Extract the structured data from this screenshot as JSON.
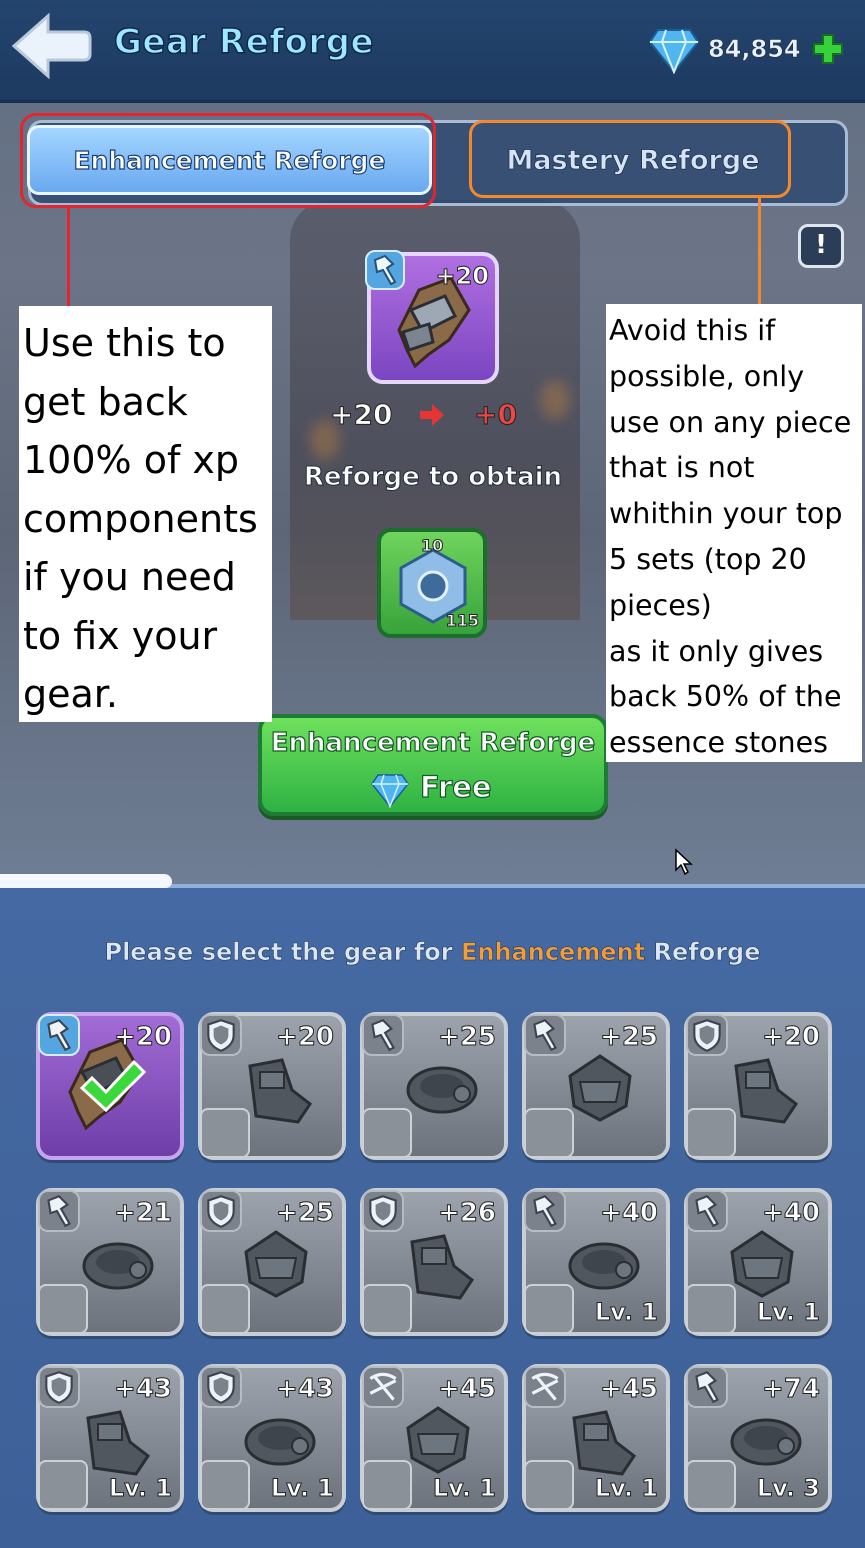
{
  "header": {
    "title": "Gear Reforge",
    "gems": "84,854"
  },
  "tabs": [
    {
      "label": "Enhancement Reforge",
      "active": true
    },
    {
      "label": "Mastery Reforge",
      "active": false
    }
  ],
  "current_gear": {
    "level": "+20",
    "from": "+20",
    "to": "+0"
  },
  "reforge_obtain_label": "Reforge to obtain",
  "reward": {
    "top_count": "10",
    "bottom_count": "115"
  },
  "action_button": {
    "label": "Enhancement Reforge",
    "cost": "Free"
  },
  "annotations": {
    "left_note": [
      "Use this to",
      "get back",
      "100% of xp",
      "components",
      "if you need",
      "to fix your",
      "gear."
    ],
    "right_note": [
      "Avoid this if",
      "possible, only",
      "use on any piece",
      "that is not",
      "whithin your top",
      "5 sets (top 20",
      "pieces)",
      "as it only gives",
      "back 50% of the",
      "essence stones"
    ]
  },
  "select_prompt": {
    "prefix": "Please select the gear for ",
    "highlight": "Enhancement",
    "suffix": " Reforge"
  },
  "gear_list": [
    {
      "plus": "+20",
      "type": "hammer",
      "selected": true,
      "lv": ""
    },
    {
      "plus": "+20",
      "type": "shield",
      "selected": false,
      "lv": ""
    },
    {
      "plus": "+25",
      "type": "hammer",
      "selected": false,
      "lv": ""
    },
    {
      "plus": "+25",
      "type": "hammer",
      "selected": false,
      "lv": ""
    },
    {
      "plus": "+20",
      "type": "shield",
      "selected": false,
      "lv": ""
    },
    {
      "plus": "+21",
      "type": "hammer",
      "selected": false,
      "lv": ""
    },
    {
      "plus": "+25",
      "type": "shield",
      "selected": false,
      "lv": ""
    },
    {
      "plus": "+26",
      "type": "shield",
      "selected": false,
      "lv": ""
    },
    {
      "plus": "+40",
      "type": "hammer",
      "selected": false,
      "lv": "Lv. 1"
    },
    {
      "plus": "+40",
      "type": "hammer",
      "selected": false,
      "lv": "Lv. 1"
    },
    {
      "plus": "+43",
      "type": "shield",
      "selected": false,
      "lv": "Lv. 1"
    },
    {
      "plus": "+43",
      "type": "shield",
      "selected": false,
      "lv": "Lv. 1"
    },
    {
      "plus": "+45",
      "type": "crossbow",
      "selected": false,
      "lv": "Lv. 1"
    },
    {
      "plus": "+45",
      "type": "crossbow",
      "selected": false,
      "lv": "Lv. 1"
    },
    {
      "plus": "+74",
      "type": "hammer",
      "selected": false,
      "lv": "Lv. 3"
    }
  ],
  "colors": {
    "header_bg": "#1d3a60",
    "active_tab": "#6aa8f0",
    "action_green": "#2eb243",
    "highlight_orange": "#f39c3a",
    "annotation_red": "#e2262f",
    "annotation_orange": "#f08a2c"
  },
  "icons": [
    "back-arrow-icon",
    "gem-icon",
    "plus-icon",
    "info-icon",
    "hammer-icon",
    "shield-icon",
    "crossbow-icon",
    "arrow-right-icon",
    "check-icon",
    "nut-icon"
  ]
}
